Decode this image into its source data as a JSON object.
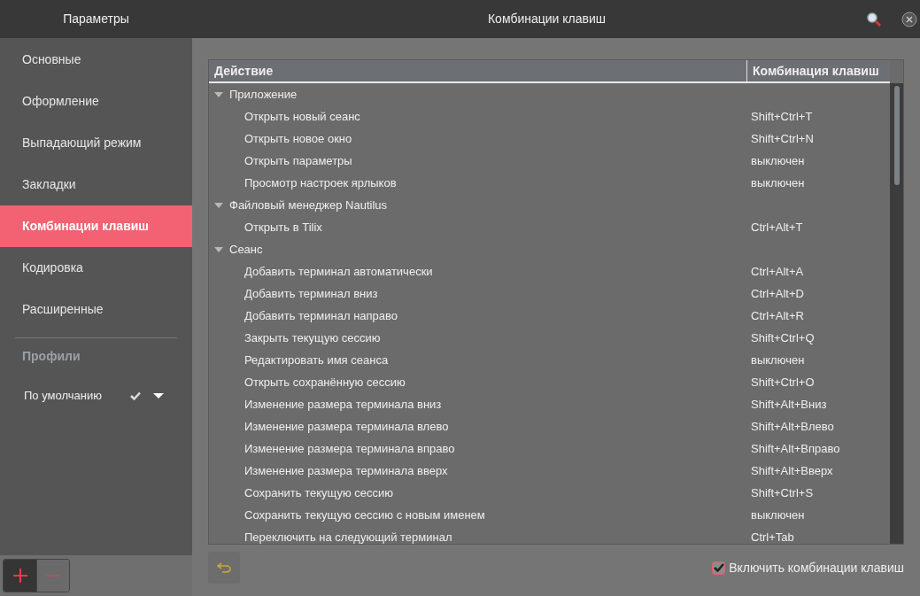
{
  "window": {
    "sidebar_title": "Параметры",
    "title": "Комбинации клавиш"
  },
  "sidebar": {
    "items": [
      {
        "label": "Основные",
        "selected": false
      },
      {
        "label": "Оформление",
        "selected": false
      },
      {
        "label": "Выпадающий режим",
        "selected": false
      },
      {
        "label": "Закладки",
        "selected": false
      },
      {
        "label": "Комбинации клавиш",
        "selected": true
      },
      {
        "label": "Кодировка",
        "selected": false
      },
      {
        "label": "Расширенные",
        "selected": false
      }
    ],
    "profiles_heading": "Профили",
    "profiles": [
      {
        "label": "По умолчанию",
        "default": true
      }
    ]
  },
  "table": {
    "columns": [
      "Действие",
      "Комбинация клавиш"
    ],
    "groups": [
      {
        "label": "Приложение",
        "expanded": true,
        "children": [
          {
            "action": "Открыть новый сеанс",
            "shortcut": "Shift+Ctrl+T"
          },
          {
            "action": "Открыть новое окно",
            "shortcut": "Shift+Ctrl+N"
          },
          {
            "action": "Открыть параметры",
            "shortcut": "выключен"
          },
          {
            "action": "Просмотр настроек ярлыков",
            "shortcut": "выключен"
          }
        ]
      },
      {
        "label": "Файловый менеджер Nautilus",
        "expanded": true,
        "children": [
          {
            "action": "Открыть в Tilix",
            "shortcut": "Ctrl+Alt+T"
          }
        ]
      },
      {
        "label": "Сеанс",
        "expanded": true,
        "children": [
          {
            "action": "Добавить терминал автоматически",
            "shortcut": "Ctrl+Alt+A"
          },
          {
            "action": "Добавить терминал вниз",
            "shortcut": "Ctrl+Alt+D"
          },
          {
            "action": "Добавить терминал направо",
            "shortcut": "Ctrl+Alt+R"
          },
          {
            "action": "Закрыть текущую сессию",
            "shortcut": "Shift+Ctrl+Q"
          },
          {
            "action": "Редактировать имя сеанса",
            "shortcut": "выключен"
          },
          {
            "action": "Открыть сохранённую сессию",
            "shortcut": "Shift+Ctrl+O"
          },
          {
            "action": "Изменение размера терминала вниз",
            "shortcut": "Shift+Alt+Вниз"
          },
          {
            "action": "Изменение размера терминала влево",
            "shortcut": "Shift+Alt+Влево"
          },
          {
            "action": "Изменение размера терминала вправо",
            "shortcut": "Shift+Alt+Вправо"
          },
          {
            "action": "Изменение размера терминала вверх",
            "shortcut": "Shift+Alt+Вверх"
          },
          {
            "action": "Сохранить текущую сессию",
            "shortcut": "Shift+Ctrl+S"
          },
          {
            "action": "Сохранить текущую сессию с новым именем",
            "shortcut": "выключен"
          },
          {
            "action": "Переключить на следующий терминал",
            "shortcut": "Ctrl+Tab"
          }
        ]
      }
    ]
  },
  "enable_shortcuts": {
    "label": "Включить комбинации клавиш",
    "checked": true
  }
}
